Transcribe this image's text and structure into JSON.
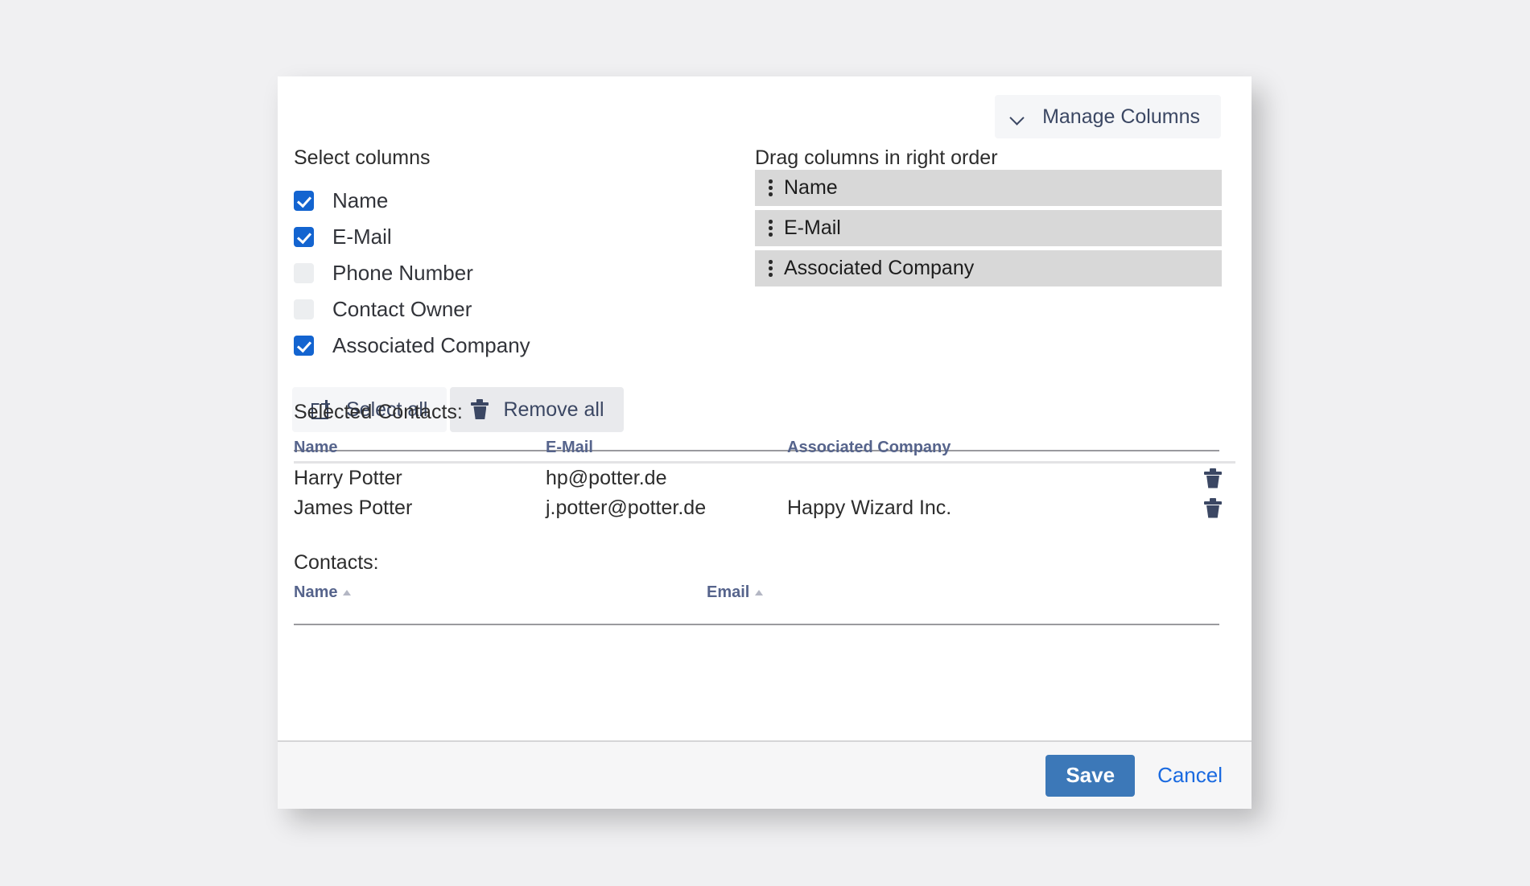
{
  "colors": {
    "page_background": "#f0f0f2",
    "checkbox_checked": "#1364d0",
    "save_button": "#3c78b8",
    "cancel_link": "#1a6ae0",
    "table_header_text": "#56648c",
    "drag_row_background": "#d8d8d8"
  },
  "toolbar": {
    "manage_columns_label": "Manage Columns",
    "chevron_icon": "chevron-down-icon"
  },
  "select_columns": {
    "heading": "Select columns",
    "items": [
      {
        "label": "Name",
        "checked": true
      },
      {
        "label": "E-Mail",
        "checked": true
      },
      {
        "label": "Phone Number",
        "checked": false
      },
      {
        "label": "Contact Owner",
        "checked": false
      },
      {
        "label": "Associated Company",
        "checked": true
      }
    ]
  },
  "bulk_actions": {
    "select_all_label": "Select all",
    "select_all_icon": "select-all-icon",
    "remove_all_label": "Remove all",
    "remove_all_icon": "trash-icon"
  },
  "drag_columns": {
    "heading": "Drag columns in right order",
    "items": [
      {
        "label": "Name"
      },
      {
        "label": "E-Mail"
      },
      {
        "label": "Associated Company"
      }
    ],
    "handle_icon": "drag-handle-icon"
  },
  "selected_contacts": {
    "title": "Selected Contacts:",
    "columns": [
      "Name",
      "E-Mail",
      "Associated Company"
    ],
    "rows": [
      {
        "name": "Harry Potter",
        "email": "hp@potter.de",
        "company": ""
      },
      {
        "name": "James Potter",
        "email": "j.potter@potter.de",
        "company": "Happy Wizard Inc."
      }
    ],
    "row_action_icon": "trash-icon"
  },
  "contacts": {
    "title": "Contacts:",
    "columns": [
      {
        "label": "Name",
        "sort": "ascending"
      },
      {
        "label": "Email",
        "sort": "ascending"
      }
    ]
  },
  "footer": {
    "save_label": "Save",
    "cancel_label": "Cancel"
  }
}
